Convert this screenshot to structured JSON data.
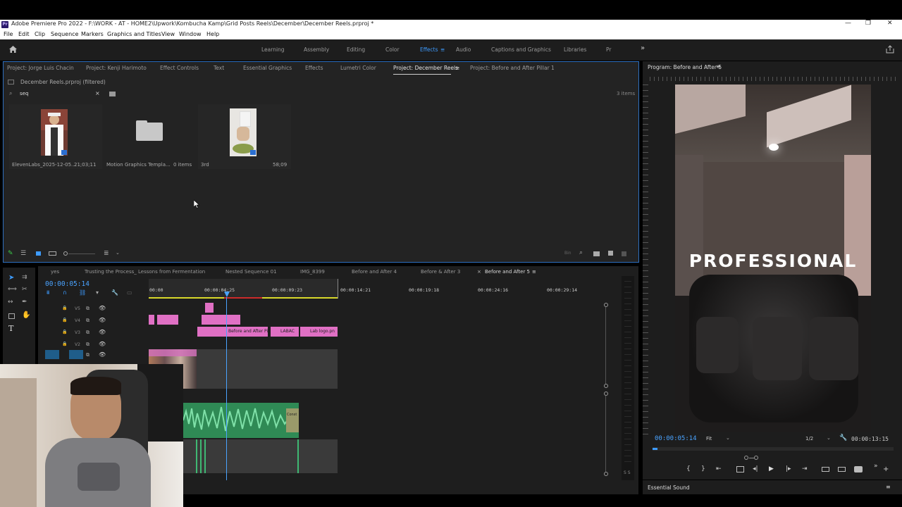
{
  "window": {
    "title": "Adobe Premiere Pro 2022 - F:\\WORK - AT - HOME2\\Upwork\\Kombucha Kamp\\Grid Posts Reels\\December\\December Reels.prproj *",
    "logo_text": "Pr",
    "minimize": "—",
    "restore": "❐",
    "close": "✕"
  },
  "menu": [
    "File",
    "Edit",
    "Clip",
    "Sequence",
    "Markers",
    "Graphics and Titles",
    "View",
    "Window",
    "Help"
  ],
  "workspaces": {
    "items": [
      "Learning",
      "Assembly",
      "Editing",
      "Color",
      "Effects",
      "Audio",
      "Captions and Graphics",
      "Libraries",
      "Pr"
    ],
    "active": "Effects",
    "overflow": "»"
  },
  "project_panel": {
    "tabs": [
      "Project: Jorge Luis Chacin",
      "Project: Kenji Harimoto",
      "Effect Controls",
      "Text",
      "Essential Graphics",
      "Effects",
      "Lumetri Color",
      "Project: December Reels",
      "Project: Before and After Pillar 1"
    ],
    "active_tab": "Project: December Reels",
    "path": "December Reels.prproj (filtered)",
    "search_value": "seq",
    "items_count": "3 items",
    "items": [
      {
        "name": "ElevenLabs_2025-12-05...",
        "meta": "21;03;11"
      },
      {
        "name": "Motion Graphics Templa...",
        "meta": "0 items"
      },
      {
        "name": "3rd",
        "meta": "58;09"
      }
    ]
  },
  "program": {
    "title": "Program: Before and After 5",
    "overlay_text": "PROFESSIONAL",
    "timecode": "00:00:05:14",
    "fit": "Fit",
    "resolution": "1/2",
    "duration": "00:00:13:15",
    "playhead_progress": 0.02
  },
  "timeline": {
    "tabs": [
      "yes",
      "Trusting the Process_ Lessons from Fermentation",
      "Nested Sequence 01",
      "IMG_8399",
      "Before and After 4",
      "Before & After 3",
      "Before and After 5"
    ],
    "active_tab": "Before and After 5",
    "timecode": "00:00:05:14",
    "ruler": [
      "00:00",
      "00:00:04:25",
      "00:00:09:23",
      "00:00:14:21",
      "00:00:19:18",
      "00:00:24:16",
      "00:00:29:14"
    ],
    "tracks": [
      "V5",
      "V4",
      "V3",
      "V2",
      "V1"
    ],
    "clips": {
      "v3_a": "Before and After Pi",
      "v3_b": "LABAC",
      "v3_c": "Lab logo.pn",
      "audio": "Const"
    }
  },
  "essential_sound": "Essential Sound",
  "colors": {
    "accent": "#3d9bff",
    "clip_pink": "#e070c4",
    "clip_green": "#3fb873",
    "timecode_blue": "#4aa3ff"
  }
}
